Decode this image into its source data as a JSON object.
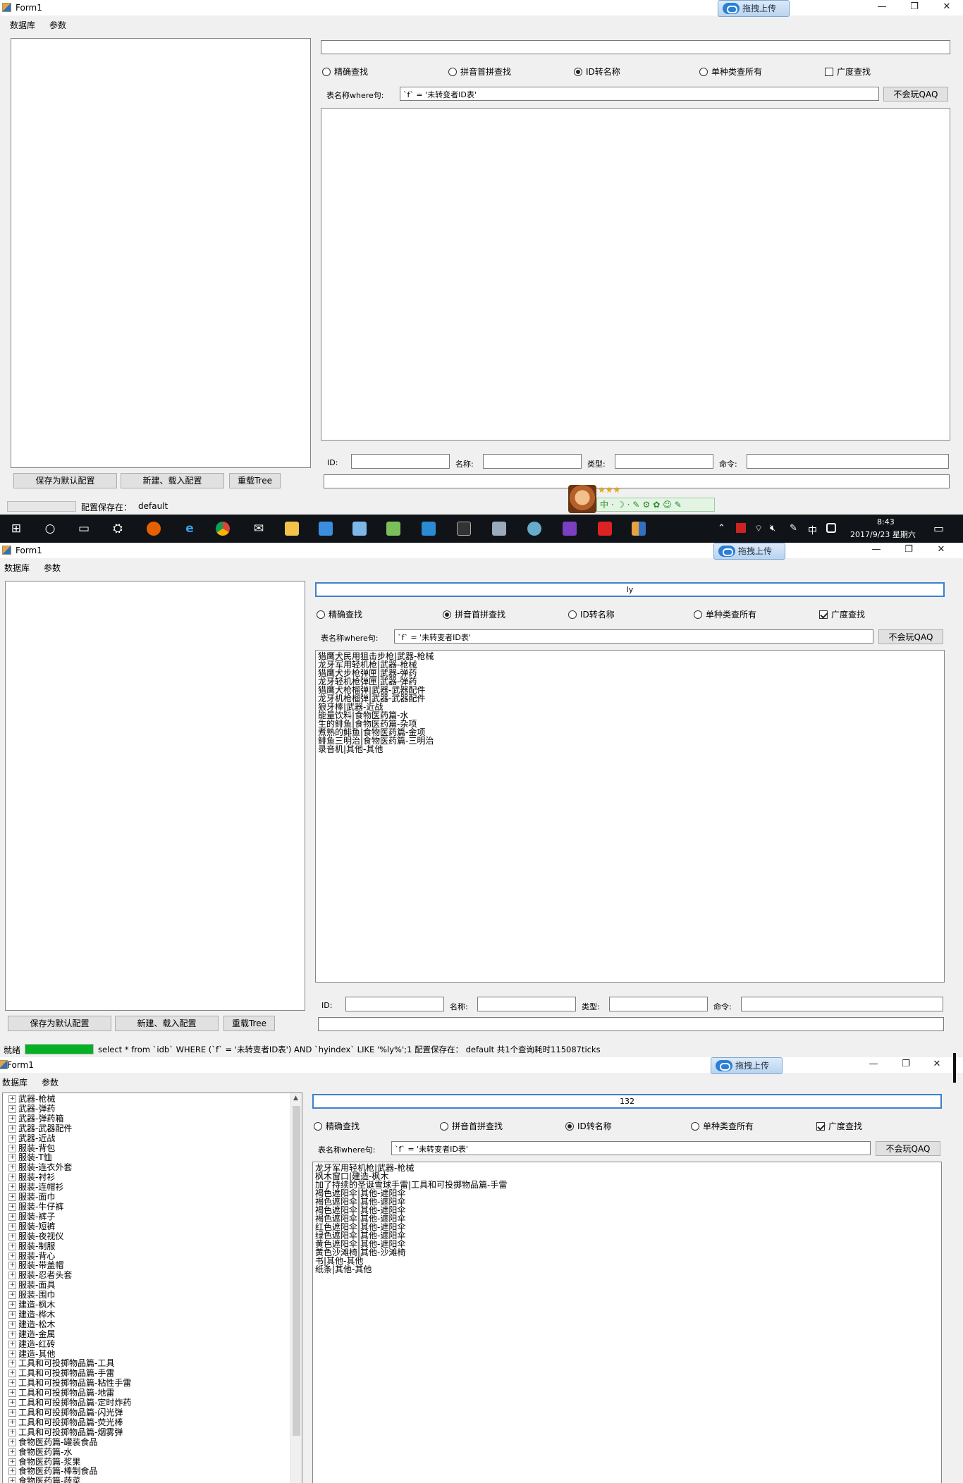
{
  "window1": {
    "title": "Form1",
    "upload_label": "拖拽上传",
    "menu": [
      "数据库",
      "参数"
    ],
    "search_value": "",
    "radios": [
      {
        "label": "精确查找",
        "checked": false
      },
      {
        "label": "拼音首拼查找",
        "checked": false
      },
      {
        "label": "ID转名称",
        "checked": true
      },
      {
        "label": "单种类查所有",
        "checked": false
      }
    ],
    "wide_search": {
      "label": "广度查找",
      "checked": false
    },
    "where_label": "表名称where句:",
    "where_value": "`f` = '未转变者ID表'",
    "qaq_button": "不会玩QAQ",
    "results": [],
    "fields": {
      "id": "ID:",
      "name": "名称:",
      "type": "类型:",
      "cmd": "命令:"
    },
    "buttons": {
      "save": "保存为默认配置",
      "new_load": "新建、载入配置",
      "reload": "重载Tree"
    },
    "status": {
      "config_label": "配置保存在：",
      "config_value": "default",
      "progress": 0
    }
  },
  "window2": {
    "title": "Form1",
    "upload_label": "拖拽上传",
    "menu": [
      "数据库",
      "参数"
    ],
    "search_value": "ly",
    "radios": [
      {
        "label": "精确查找",
        "checked": false
      },
      {
        "label": "拼音首拼查找",
        "checked": true
      },
      {
        "label": "ID转名称",
        "checked": false
      },
      {
        "label": "单种类查所有",
        "checked": false
      }
    ],
    "wide_search": {
      "label": "广度查找",
      "checked": true
    },
    "where_label": "表名称where句:",
    "where_value": "`f` = '未转变者ID表'",
    "qaq_button": "不会玩QAQ",
    "results": [
      "猎鹰犬民用狙击步枪|武器-枪械",
      "龙牙军用轻机枪|武器-枪械",
      "猎鹰犬步枪弹匣|武器-弹药",
      "龙牙轻机枪弹匣|武器-弹药",
      "猎鹰犬枪榴弹|武器-武器配件",
      "龙牙机枪榴弹|武器-武器配件",
      "狼牙棒|武器-近战",
      "能量饮料|食物医药篇-水",
      "生的鲱鱼|食物医药篇-杂项",
      "煮熟的鲱鱼|食物医药篇-金项",
      "鲱鱼三明治|食物医药篇-三明治",
      "录音机|其他-其他"
    ],
    "fields": {
      "id": "ID:",
      "name": "名称:",
      "type": "类型:",
      "cmd": "命令:"
    },
    "buttons": {
      "save": "保存为默认配置",
      "new_load": "新建、载入配置",
      "reload": "重载Tree"
    },
    "status": {
      "ready": "就绪",
      "progress": 100,
      "message": "select * from `idb` WHERE (`f` = '未转变者ID表') AND `hyindex` LIKE '%ly%';1  配置保存在：  default  共1个查询耗时115087ticks"
    }
  },
  "window3": {
    "title": "Form1",
    "upload_label": "拖拽上传",
    "menu": [
      "数据库",
      "参数"
    ],
    "search_value": "132",
    "radios": [
      {
        "label": "精确查找",
        "checked": false
      },
      {
        "label": "拼音首拼查找",
        "checked": false
      },
      {
        "label": "ID转名称",
        "checked": true
      },
      {
        "label": "单种类查所有",
        "checked": false
      }
    ],
    "wide_search": {
      "label": "广度查找",
      "checked": true
    },
    "where_label": "表名称where句:",
    "where_value": "`f` = '未转变者ID表'",
    "qaq_button": "不会玩QAQ",
    "results": [
      "龙牙军用轻机枪|武器-枪械",
      "枫木窗口|建造-枫木",
      "加了持续的圣诞雪球手雷|工具和可投掷物品篇-手雷",
      "褐色遮阳伞|其他-遮阳伞",
      "褐色遮阳伞|其他-遮阳伞",
      "褐色遮阳伞|其他-遮阳伞",
      "褐色遮阳伞|其他-遮阳伞",
      "红色遮阳伞|其他-遮阳伞",
      "绿色遮阳伞|其他-遮阳伞",
      "黄色遮阳伞|其他-遮阳伞",
      "黄色沙滩椅|其他-沙滩椅",
      "书|其他-其他",
      "纸条|其他-其他"
    ],
    "tree": [
      "武器-枪械",
      "武器-弹药",
      "武器-弹药箱",
      "武器-武器配件",
      "武器-近战",
      "服装-背包",
      "服装-T恤",
      "服装-连衣外套",
      "服装-衬衫",
      "服装-连帽衫",
      "服装-面巾",
      "服装-牛仔裤",
      "服装-裤子",
      "服装-短裤",
      "服装-夜视仪",
      "服装-制服",
      "服装-背心",
      "服装-带盖帽",
      "服装-忍者头套",
      "服装-面具",
      "服装-围巾",
      "建造-枫木",
      "建造-桦木",
      "建造-松木",
      "建造-金属",
      "建造-红砖",
      "建造-其他",
      "工具和可投掷物品篇-工具",
      "工具和可投掷物品篇-手雷",
      "工具和可投掷物品篇-粘性手雷",
      "工具和可投掷物品篇-地雷",
      "工具和可投掷物品篇-定时炸药",
      "工具和可投掷物品篇-闪光弹",
      "工具和可投掷物品篇-荧光棒",
      "工具和可投掷物品篇-烟雾弹",
      "食物医药篇-罐装食品",
      "食物医药篇-水",
      "食物医药篇-浆果",
      "食物医药篇-棒制食品",
      "食物医药篇-蔬菜"
    ]
  },
  "taskbar": {
    "time": "8:43",
    "date": "2017/9/23 星期六",
    "ime": "中"
  },
  "ime_toolbar": {
    "lang": "中"
  },
  "colors": {
    "progress": "#06b025",
    "focus_border": "#3c7fd0",
    "taskbar": "#101318"
  }
}
